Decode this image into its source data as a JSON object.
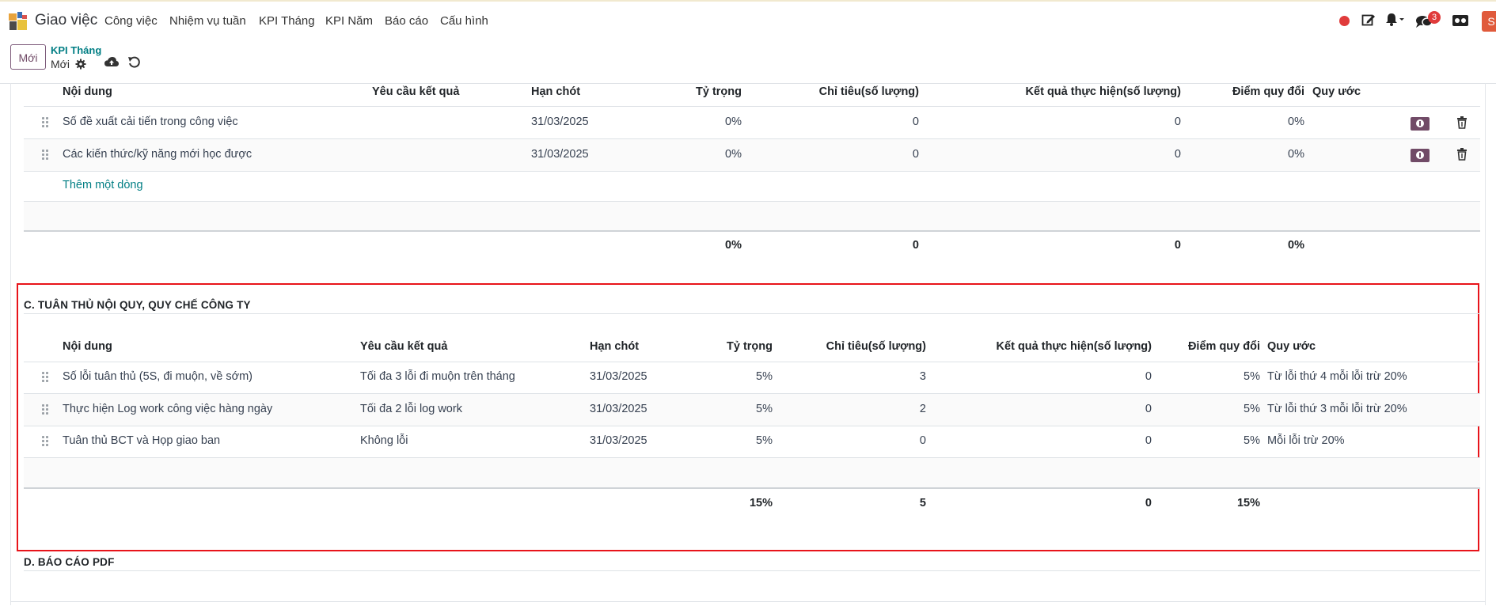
{
  "app": {
    "title": "Giao việc"
  },
  "menu": [
    "Công việc",
    "Nhiệm vụ tuần",
    "KPI Tháng",
    "KPI Năm",
    "Báo cáo",
    "Cấu hình"
  ],
  "systray": {
    "chat_badge": "3",
    "avatar_letter": "S",
    "colors": {
      "record": "#e03b3b",
      "avatar": "#e05a3b"
    }
  },
  "control": {
    "new_button": "Mới",
    "breadcrumb_parent": "KPI Tháng",
    "breadcrumb_current": "Mới"
  },
  "section_b": {
    "headers": [
      "Nội dung",
      "Yêu cầu kết quả",
      "Hạn chót",
      "Tỷ trọng",
      "Chỉ tiêu(số lượng)",
      "Kết quả thực hiện(số lượng)",
      "Điểm quy đổi",
      "Quy ước"
    ],
    "rows": [
      {
        "content": "Số đề xuất cải tiến trong công việc",
        "requirement": "",
        "deadline": "31/03/2025",
        "weight": "0%",
        "target": "0",
        "result": "0",
        "score": "0%",
        "rule": ""
      },
      {
        "content": "Các kiến thức/kỹ năng mới học được",
        "requirement": "",
        "deadline": "31/03/2025",
        "weight": "0%",
        "target": "0",
        "result": "0",
        "score": "0%",
        "rule": ""
      }
    ],
    "add_line": "Thêm một dòng",
    "totals": {
      "weight": "0%",
      "target": "0",
      "result": "0",
      "score": "0%"
    }
  },
  "section_c": {
    "title": "C. TUÂN THỦ NỘI QUY, QUY CHẾ CÔNG TY",
    "headers": [
      "Nội dung",
      "Yêu cầu kết quả",
      "Hạn chót",
      "Tỷ trọng",
      "Chỉ tiêu(số lượng)",
      "Kết quả thực hiện(số lượng)",
      "Điểm quy đổi",
      "Quy ước"
    ],
    "rows": [
      {
        "content": "Số lỗi tuân thủ (5S, đi muộn, về sớm)",
        "requirement": "Tối đa 3 lỗi đi muộn trên tháng",
        "deadline": "31/03/2025",
        "weight": "5%",
        "target": "3",
        "result": "0",
        "score": "5%",
        "rule": "Từ lỗi thứ 4 mỗi lỗi trừ 20%"
      },
      {
        "content": "Thực hiện Log work công việc hàng ngày",
        "requirement": "Tối đa 2 lỗi log work",
        "deadline": "31/03/2025",
        "weight": "5%",
        "target": "2",
        "result": "0",
        "score": "5%",
        "rule": "Từ lỗi thứ 3 mỗi lỗi trừ 20%"
      },
      {
        "content": "Tuân thủ BCT và Họp giao ban",
        "requirement": "Không lỗi",
        "deadline": "31/03/2025",
        "weight": "5%",
        "target": "0",
        "result": "0",
        "score": "5%",
        "rule": "Mỗi lỗi trừ 20%"
      }
    ],
    "totals": {
      "weight": "15%",
      "target": "5",
      "result": "0",
      "score": "15%"
    }
  },
  "section_d": {
    "title": "D. BÁO CÁO PDF"
  }
}
